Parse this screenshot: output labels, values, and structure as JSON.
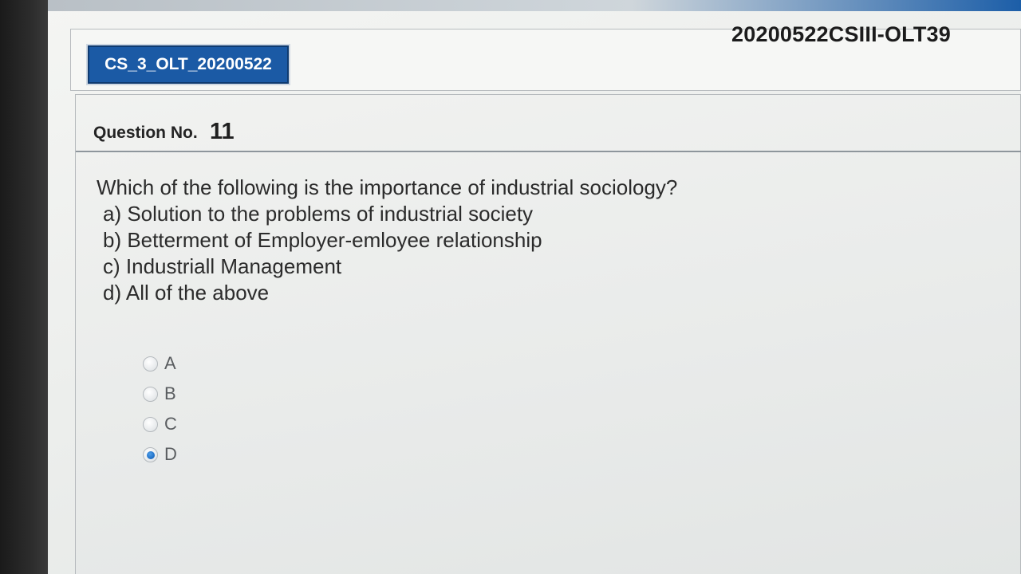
{
  "header": {
    "exam_id": "20200522CSIII-OLT39",
    "course_code": "CS_3_OLT_20200522"
  },
  "question": {
    "label": "Question No.",
    "number": "11",
    "text": "Which of the following is the importance of industrial sociology?",
    "choices": [
      "a) Solution to the problems of industrial society",
      "b) Betterment of Employer-emloyee relationship",
      "c) Industriall Management",
      "d) All of the above"
    ]
  },
  "answers": {
    "options": [
      "A",
      "B",
      "C",
      "D"
    ],
    "selected": "D"
  },
  "colors": {
    "badge_background": "#1b5aa5",
    "radio_selected": "#1c6cc4"
  }
}
